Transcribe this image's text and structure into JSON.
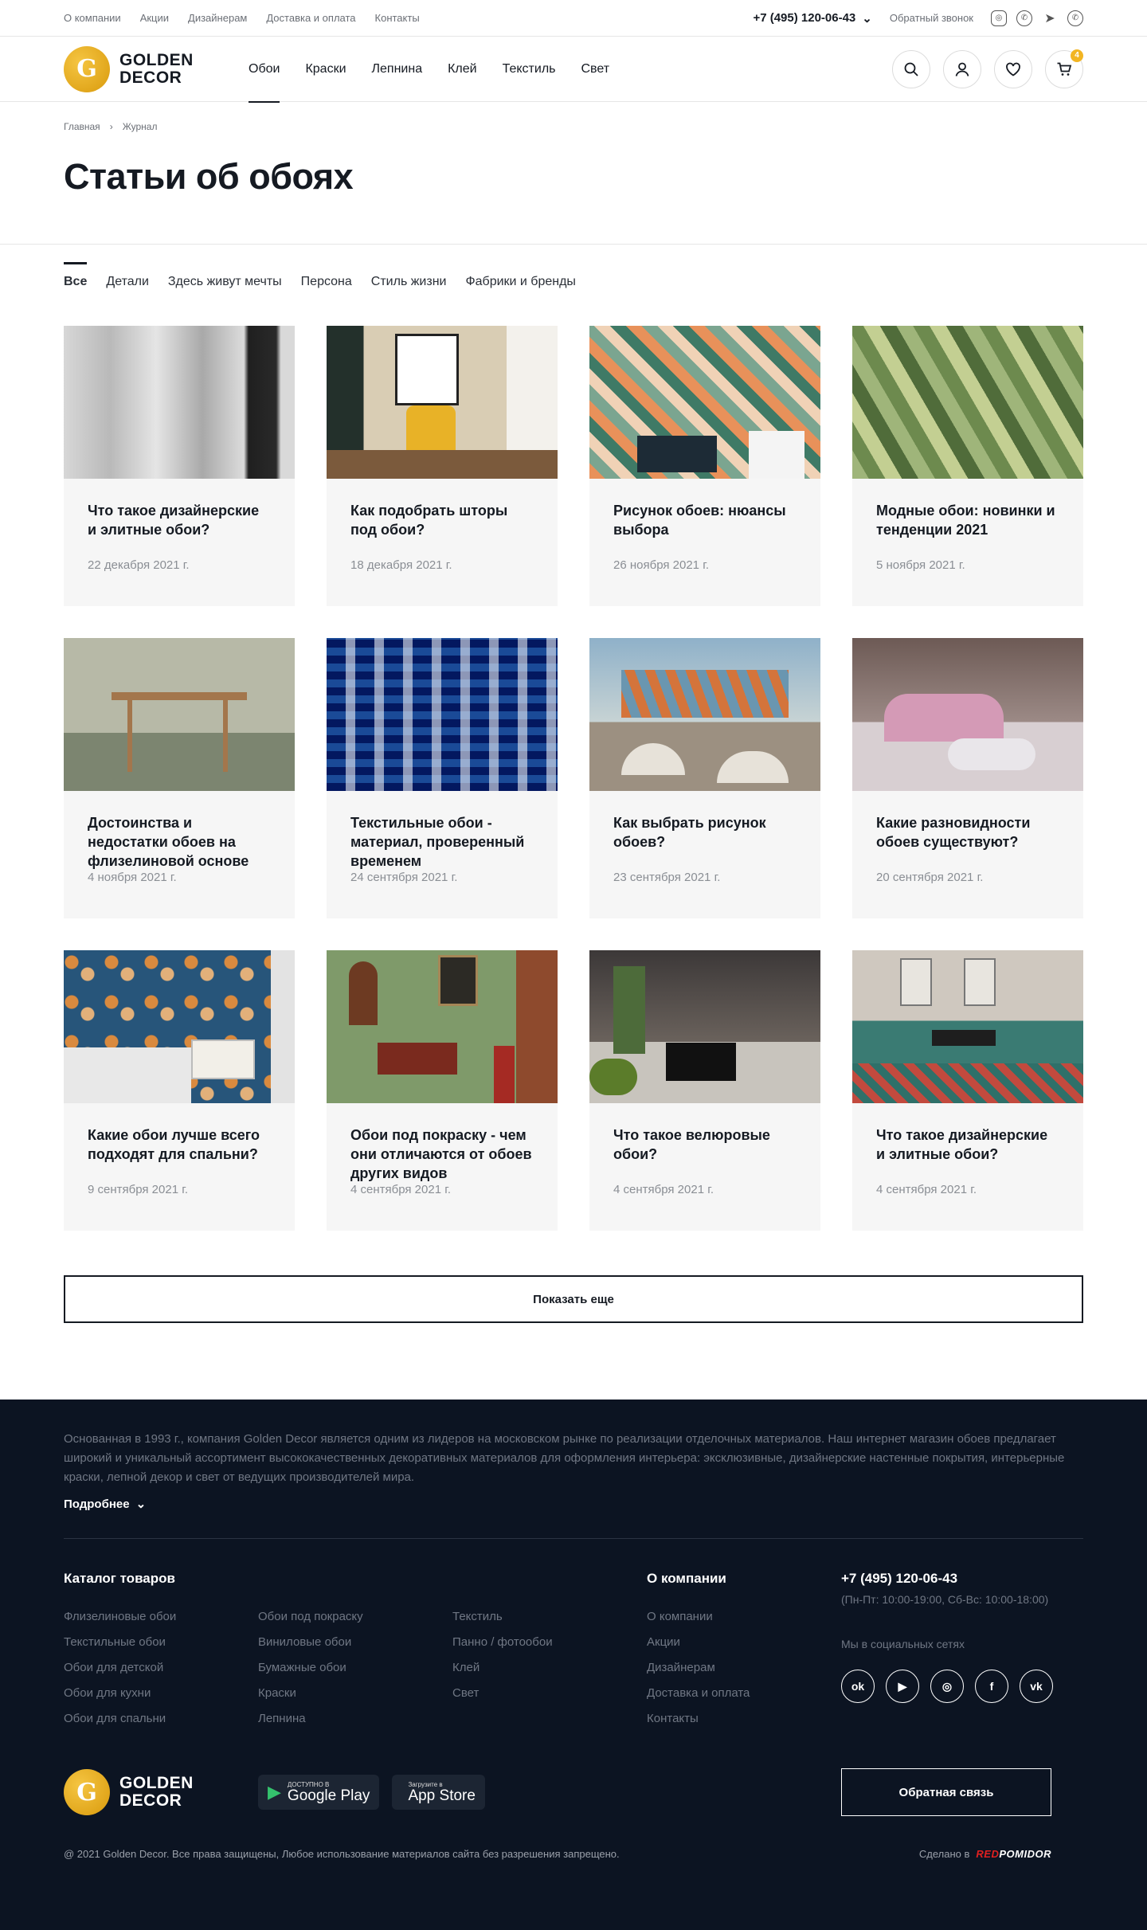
{
  "topbar": {
    "links": [
      "О компании",
      "Акции",
      "Дизайнерам",
      "Доставка и оплата",
      "Контакты"
    ],
    "phone": "+7 (495) 120-06-43",
    "callback": "Обратный звонок"
  },
  "header": {
    "logo_line1": "GOLDEN",
    "logo_line2": "DECOR",
    "nav": [
      "Обои",
      "Краски",
      "Лепнина",
      "Клей",
      "Текстиль",
      "Свет"
    ],
    "cart_count": "4"
  },
  "breadcrumb": [
    "Главная",
    "Журнал"
  ],
  "page_title": "Статьи об обоях",
  "tabs": [
    "Все",
    "Детали",
    "Здесь живут мечты",
    "Персона",
    "Стиль жизни",
    "Фабрики и бренды"
  ],
  "articles": [
    {
      "title": "Что такое дизайнерские и элитные обои?",
      "date": "22 декабря 2021 г."
    },
    {
      "title": "Как подобрать шторы под обои?",
      "date": "18 декабря 2021 г."
    },
    {
      "title": "Рисунок обоев: нюансы выбора",
      "date": "26 ноября 2021 г."
    },
    {
      "title": "Модные обои: новинки и тенденции 2021",
      "date": "5 ноября 2021 г."
    },
    {
      "title": "Достоинства и недостатки обоев на флизелиновой основе",
      "date": "4 ноября 2021 г."
    },
    {
      "title": "Текстильные обои - материал, проверенный временем",
      "date": "24 сентября 2021 г."
    },
    {
      "title": "Как выбрать рисунок обоев?",
      "date": "23 сентября 2021 г."
    },
    {
      "title": "Какие разновидности обоев существуют?",
      "date": "20 сентября 2021 г."
    },
    {
      "title": "Какие обои лучше всего подходят для спальни?",
      "date": "9 сентября 2021 г."
    },
    {
      "title": "Обои под покраску - чем они отличаются от обоев других видов",
      "date": "4 сентября 2021 г."
    },
    {
      "title": "Что такое велюровые обои?",
      "date": "4 сентября 2021 г."
    },
    {
      "title": "Что такое дизайнерские и элитные обои?",
      "date": "4 сентября 2021 г."
    }
  ],
  "show_more": "Показать еще",
  "footer": {
    "about": "Основанная в 1993 г., компания Golden Decor является одним из лидеров на московском рынке по реализации отделочных материалов. Наш интернет магазин обоев предлагает широкий и уникальный ассортимент высококачественных декоративных материалов для оформления интерьера: эксклюзивные, дизайнерские настенные покрытия, интерьерные краски, лепной декор и свет от ведущих производителей мира.",
    "read_more": "Подробнее",
    "catalog_title": "Каталог товаров",
    "catalog": [
      [
        "Флизелиновые обои",
        "Текстильные обои",
        "Обои для детской",
        "Обои для кухни",
        "Обои для спальни"
      ],
      [
        "Обои под покраску",
        "Виниловые обои",
        "Бумажные обои",
        "Краски",
        "Лепнина"
      ],
      [
        "Текстиль",
        "Панно / фотообои",
        "Клей",
        "Свет"
      ]
    ],
    "company_title": "О компании",
    "company": [
      "О компании",
      "Акции",
      "Дизайнерам",
      "Доставка и оплата",
      "Контакты"
    ],
    "phone": "+7 (495) 120-06-43",
    "hours": "(Пн-Пт: 10:00-19:00, Сб-Вс: 10:00-18:00)",
    "social_label": "Мы в социальных сетях",
    "google_small": "ДОСТУПНО В",
    "google_big": "Google Play",
    "apple_small": "Загрузите в",
    "apple_big": "App Store",
    "feedback": "Обратная связь",
    "copyright": "@ 2021 Golden Decor. Все права защищены, Любое использование материалов сайта без разрешения запрещено.",
    "made_by": "Сделано в",
    "made_red": "RED",
    "made_brand": "POMIDOR"
  },
  "colors": {
    "accent": "#f2b523",
    "footer_bg": "#0c1422"
  }
}
